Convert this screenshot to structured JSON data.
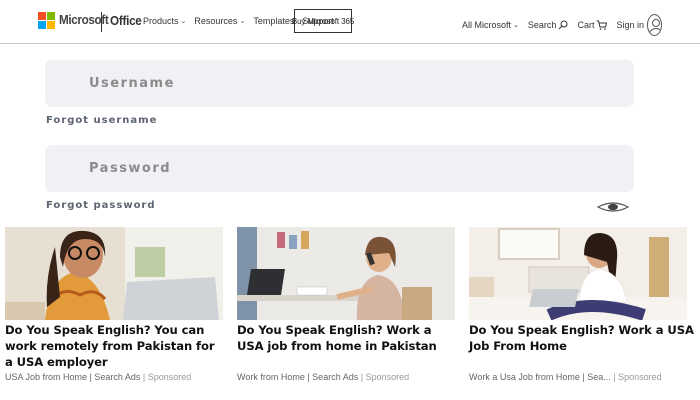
{
  "header": {
    "brand": "Microsoft",
    "product": "Office",
    "nav": [
      {
        "label": "Products",
        "dropdown": true
      },
      {
        "label": "Resources",
        "dropdown": true
      },
      {
        "label": "Templates",
        "dropdown": false
      },
      {
        "label": "Support",
        "dropdown": false
      }
    ],
    "buy_label": "Buy Microsoft 365",
    "all_microsoft": "All Microsoft",
    "search": "Search",
    "cart": "Cart",
    "signin": "Sign in",
    "logo_colors": [
      "#f25022",
      "#7fba00",
      "#00a4ef",
      "#ffb900"
    ]
  },
  "form": {
    "username_placeholder": "Username",
    "forgot_username": "Forgot username",
    "password_placeholder": "Password",
    "forgot_password": "Forgot password"
  },
  "ads": [
    {
      "title": "Do You Speak English? You can work remotely from Pakistan for a USA employer",
      "source": "USA Job from Home | Search Ads",
      "sponsored": "| Sponsored",
      "image": "woman-with-glasses-laptop"
    },
    {
      "title": "Do You Speak English? Work a USA job from home in Pakistan",
      "source": "Work from Home | Search Ads",
      "sponsored": "| Sponsored",
      "image": "woman-on-phone-at-desk"
    },
    {
      "title": "Do You Speak English? Work a USA Job From Home",
      "source": "Work a Usa Job from Home | Sea...",
      "sponsored": "| Sponsored",
      "image": "woman-laptop-on-bed"
    }
  ]
}
